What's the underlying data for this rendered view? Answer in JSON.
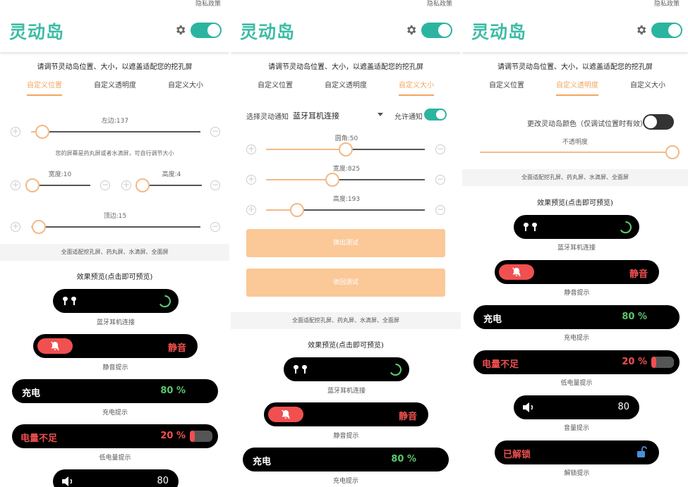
{
  "app": {
    "title": "灵动岛",
    "privacy_link": "隐私政策"
  },
  "instruction": "请调节灵动岛位置、大小，以遮盖适配您的挖孔屏",
  "tabs": [
    "自定义位置",
    "自定义透明度",
    "自定义大小"
  ],
  "position_panel": {
    "left_label": "左边:137",
    "hint": "您的屏幕是药丸屏或者水滴屏，可自行调节大小",
    "width_label": "宽度:10",
    "height_label": "高度:4",
    "top_label": "顶边:15",
    "left_value": 137,
    "width_value": 10,
    "height_value": 4,
    "top_value": 15
  },
  "size_panel": {
    "select_label": "选择灵动通知",
    "select_value": "蓝牙耳机连接",
    "allow_label": "允许通知",
    "radius_label": "圆角:50",
    "width_label": "宽度:825",
    "height_label": "高度:193",
    "popup_button": "弹出测试",
    "collapse_button": "收回测试"
  },
  "opacity_panel": {
    "color_label": "更改灵动岛颜色（仅调试位置时有效）",
    "opacity_label": "不透明度"
  },
  "compat_text": "全面适配挖孔屏、药丸屏、水滴屏、全面屏",
  "preview": {
    "title": "效果预览(点击即可预览)",
    "bluetooth_caption": "蓝牙耳机连接",
    "mute_text": "静音",
    "mute_caption": "静音提示",
    "charging_text": "充电",
    "charging_percent": "80 %",
    "charging_caption": "充电提示",
    "low_battery_text": "电量不足",
    "low_battery_percent": "20 %",
    "low_battery_caption": "低电量提示",
    "volume_value": "80",
    "volume_caption": "音量提示",
    "unlock_text": "已解锁",
    "unlock_caption": "解锁提示"
  },
  "colors": {
    "accent_teal": "#2bb5a0",
    "accent_orange": "#f2a55e",
    "charge_green": "#5ac86e",
    "alert_red": "#f05050"
  }
}
